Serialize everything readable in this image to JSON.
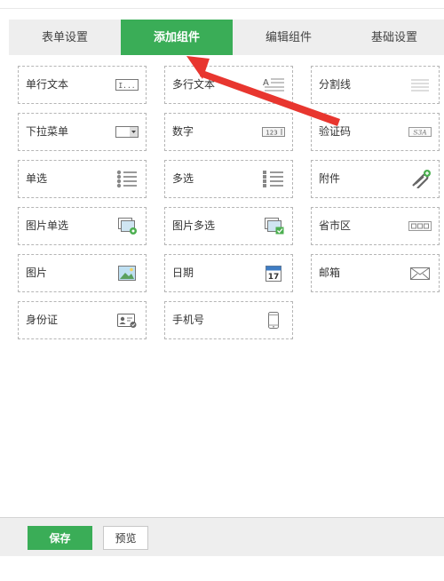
{
  "tabs": [
    {
      "label": "表单设置",
      "active": false
    },
    {
      "label": "添加组件",
      "active": true
    },
    {
      "label": "编辑组件",
      "active": false
    },
    {
      "label": "基础设置",
      "active": false
    }
  ],
  "components": [
    {
      "label": "单行文本",
      "icon": "single-line-text-icon"
    },
    {
      "label": "多行文本",
      "icon": "multi-line-text-icon"
    },
    {
      "label": "分割线",
      "icon": "divider-icon"
    },
    {
      "label": "下拉菜单",
      "icon": "dropdown-icon"
    },
    {
      "label": "数字",
      "icon": "number-icon"
    },
    {
      "label": "验证码",
      "icon": "captcha-icon"
    },
    {
      "label": "单选",
      "icon": "radio-list-icon"
    },
    {
      "label": "多选",
      "icon": "checkbox-list-icon"
    },
    {
      "label": "附件",
      "icon": "attachment-icon"
    },
    {
      "label": "图片单选",
      "icon": "image-radio-icon"
    },
    {
      "label": "图片多选",
      "icon": "image-checkbox-icon"
    },
    {
      "label": "省市区",
      "icon": "region-icon"
    },
    {
      "label": "图片",
      "icon": "image-icon"
    },
    {
      "label": "日期",
      "icon": "calendar-icon"
    },
    {
      "label": "邮箱",
      "icon": "envelope-icon"
    },
    {
      "label": "身份证",
      "icon": "id-card-icon"
    },
    {
      "label": "手机号",
      "icon": "mobile-phone-icon"
    }
  ],
  "icon_text": {
    "single_line": "I...",
    "number": "123",
    "captcha": "S3A",
    "calendar_day": "17"
  },
  "footer": {
    "save_label": "保存",
    "preview_label": "预览"
  },
  "colors": {
    "accent": "#3aad57",
    "annotation_arrow": "#e8362f"
  }
}
